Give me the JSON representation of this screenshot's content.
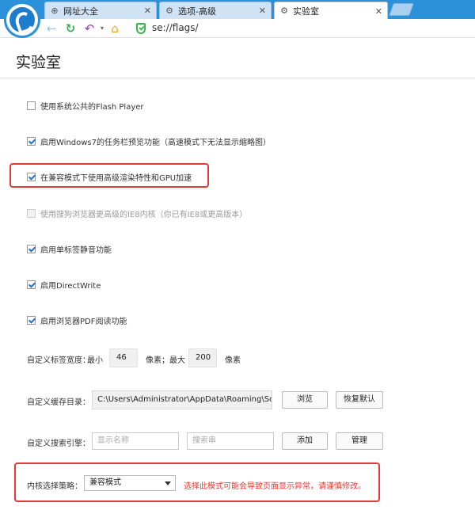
{
  "tabs": [
    {
      "label": "网址大全",
      "icon": "globe-icon"
    },
    {
      "label": "选项-高级",
      "icon": "gear-icon"
    },
    {
      "label": "实验室",
      "icon": "gear-icon"
    }
  ],
  "toolbar": {
    "address": "se://flags/"
  },
  "page": {
    "title": "实验室"
  },
  "options": [
    {
      "label": "使用系统公共的Flash Player",
      "checked": false,
      "disabled": false
    },
    {
      "label": "启用Windows7的任务栏预览功能（高速模式下无法显示缩略图）",
      "checked": true,
      "disabled": false
    },
    {
      "label": "在兼容模式下使用高级渲染特性和GPU加速",
      "checked": true,
      "disabled": false
    },
    {
      "label": "使用搜狗浏览器更高级的IE8内核（你已有IE8或更高版本）",
      "checked": false,
      "disabled": true
    },
    {
      "label": "启用单标签静音功能",
      "checked": true,
      "disabled": false
    },
    {
      "label": "启用DirectWrite",
      "checked": true,
      "disabled": false
    },
    {
      "label": "启用浏览器PDF阅读功能",
      "checked": true,
      "disabled": false
    }
  ],
  "tab_width": {
    "label": "自定义标签宽度：",
    "min_label": "最小",
    "min_value": "46",
    "unit1": "像素；最大",
    "max_value": "200",
    "unit2": "像素"
  },
  "cache": {
    "label": "自定义缓存目录：",
    "path": "C:\\Users\\Administrator\\AppData\\Roaming\\Sogou",
    "browse_button": "浏览",
    "restore_button": "恢复默认"
  },
  "search_engine": {
    "label": "自定义搜索引擎：",
    "name_placeholder": "显示名称",
    "query_placeholder": "搜索串",
    "add_button": "添加",
    "manage_button": "管理"
  },
  "kernel": {
    "label": "内核选择策略：",
    "selected": "兼容模式",
    "warning": "选择此模式可能会导致页面显示异常，请谨慎修改。"
  }
}
